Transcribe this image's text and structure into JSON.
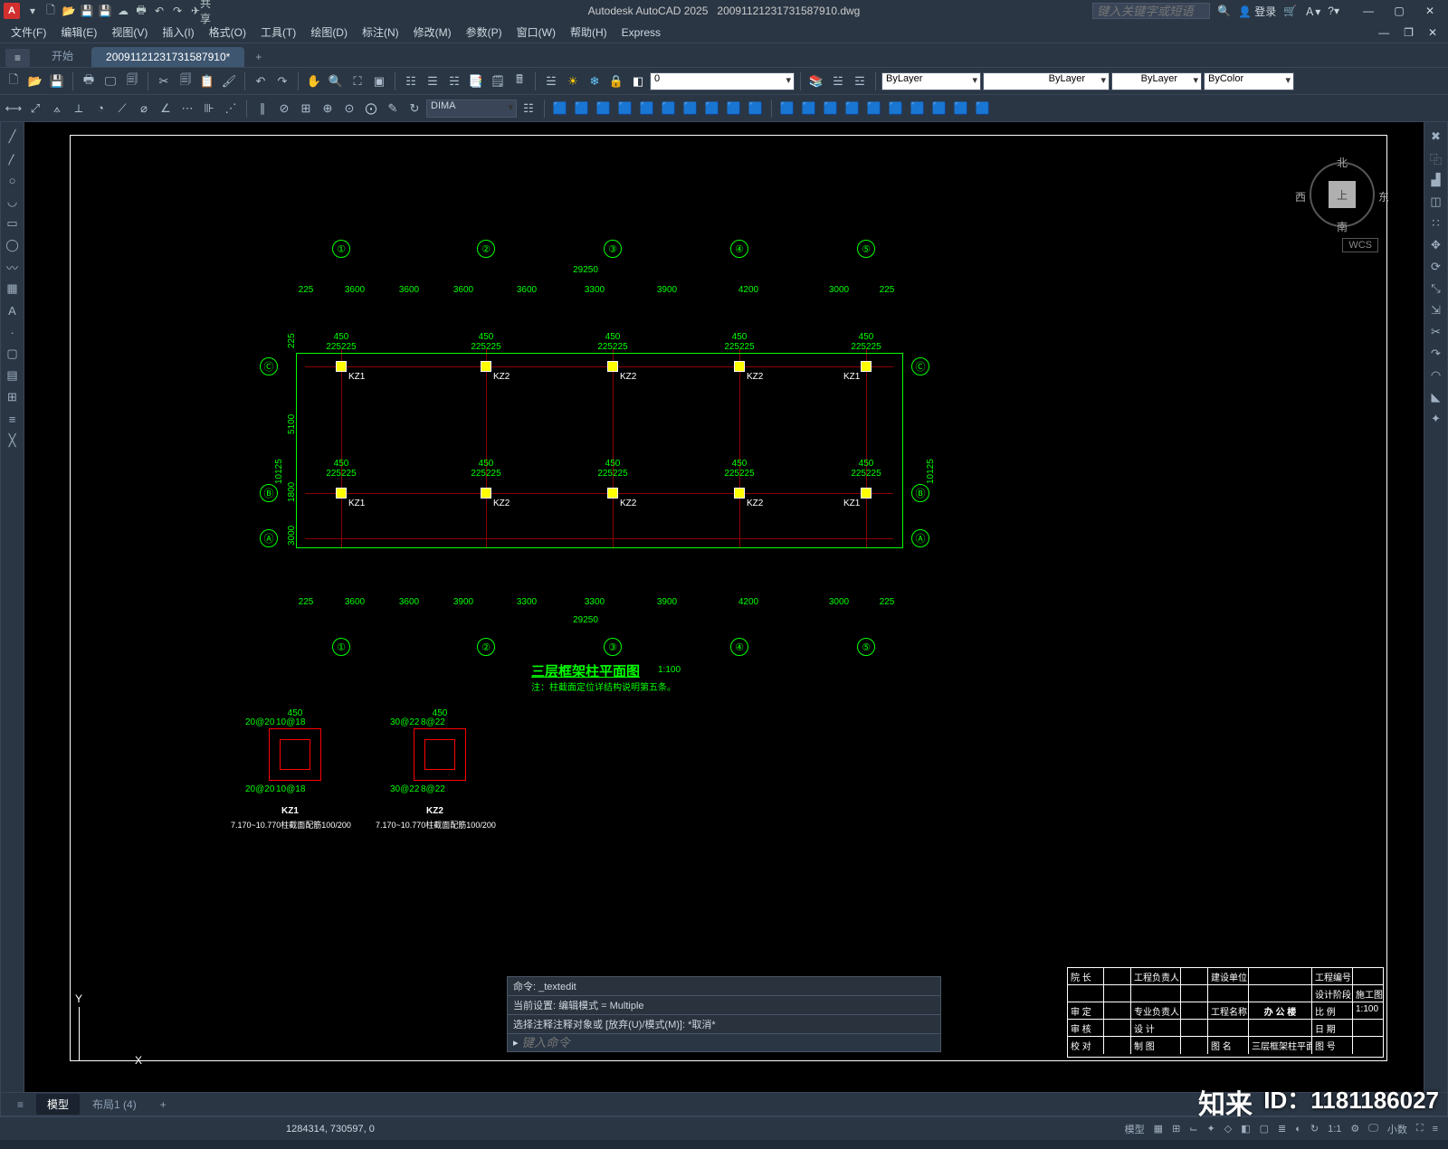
{
  "titlebar": {
    "app_letter": "A",
    "product": "Autodesk AutoCAD 2025",
    "filename": "20091121231731587910.dwg",
    "share": "共享",
    "search_placeholder": "键入关键字或短语",
    "login": "登录"
  },
  "menu": {
    "items": [
      "文件(F)",
      "编辑(E)",
      "视图(V)",
      "插入(I)",
      "格式(O)",
      "工具(T)",
      "绘图(D)",
      "标注(N)",
      "修改(M)",
      "参数(P)",
      "窗口(W)",
      "帮助(H)",
      "Express"
    ]
  },
  "tabs": {
    "hamburger": "≡",
    "items": [
      "开始",
      "20091121231731587910*"
    ],
    "activeIndex": 1,
    "plus": "+"
  },
  "toolbars": {
    "combo_zero": "0",
    "combo_dim": "DIMA",
    "bylayer": "ByLayer",
    "bycolor": "ByColor"
  },
  "viewcube": {
    "top": "上",
    "n": "北",
    "e": "东",
    "s": "南",
    "w": "西"
  },
  "wcs": "WCS",
  "drawing": {
    "title": "三层框架柱平面图",
    "scale": "1:100",
    "note": "注：柱截面定位详结构说明第五条。",
    "top_total": "29250",
    "bottom_total": "29250",
    "h_dims": [
      "225",
      "3600",
      "3600",
      "3600",
      "3600",
      "3300",
      "3900",
      "4200",
      "3000",
      "225"
    ],
    "h_dims2": [
      "225",
      "3600",
      "3600",
      "3900",
      "3300",
      "3300",
      "3900",
      "4200",
      "3000",
      "225"
    ],
    "v_dims": [
      "225",
      "5100",
      "1800",
      "3000"
    ],
    "total_v": "10125",
    "axis_v1": "450",
    "axis_v2": "225225",
    "grid_h": [
      "①",
      "②",
      "③",
      "④",
      "⑤"
    ],
    "grid_v": [
      "Ⓐ",
      "Ⓑ",
      "Ⓒ"
    ],
    "cols_row1": [
      "KZ1",
      "KZ2",
      "KZ2",
      "KZ2",
      "KZ1"
    ],
    "cols_row2": [
      "KZ1",
      "KZ2",
      "KZ2",
      "KZ2",
      "KZ1"
    ],
    "detail1": "KZ1",
    "detail2": "KZ2",
    "detail_sub": "7.170~10.770柱截面配筋100/200",
    "dim450": "450",
    "dim20": "20@20",
    "dim10": "10@18",
    "dim30": "30@22",
    "dim8": "8@22"
  },
  "titleblock": {
    "rows": [
      {
        "c1": "院 长",
        "c2": "",
        "c3": "工程负责人",
        "c4": "",
        "c5": "建设单位",
        "c6": "",
        "c7": "工程编号",
        "c8": ""
      },
      {
        "c1": "",
        "c2": "",
        "c3": "",
        "c4": "",
        "c5": "",
        "c6": "",
        "c7": "设计阶段",
        "c8": "施工图"
      },
      {
        "c1": "审 定",
        "c2": "",
        "c3": "专业负责人",
        "c4": "",
        "c5": "工程名称",
        "c6": "办 公 楼",
        "c7": "比 例",
        "c8": "1:100"
      },
      {
        "c1": "审 核",
        "c2": "",
        "c3": "设  计",
        "c4": "",
        "c5": "",
        "c6": "",
        "c7": "日  期",
        "c8": ""
      },
      {
        "c1": "校 对",
        "c2": "",
        "c3": "制  图",
        "c4": "",
        "c5": "图  名",
        "c6": "三层框架柱平面图",
        "c7": "图  号",
        "c8": ""
      }
    ]
  },
  "cmd": {
    "hist1": "命令: _textedit",
    "hist2": "当前设置: 编辑模式 = Multiple",
    "hist3": "选择注释注释对象或 [放弃(U)/模式(M)]: *取消*",
    "prompt_icon": "▸",
    "placeholder": "键入命令"
  },
  "ucs": {
    "x": "X",
    "y": "Y"
  },
  "layout_tabs": {
    "items": [
      "模型",
      "布局1 (4)"
    ],
    "activeIndex": 0,
    "plus": "+"
  },
  "status": {
    "coords": "1284314, 730597, 0",
    "mode": "模型",
    "scale": "1:1",
    "dec": "小数"
  },
  "watermark": {
    "logo": "知来",
    "id": "ID：1181186027"
  }
}
